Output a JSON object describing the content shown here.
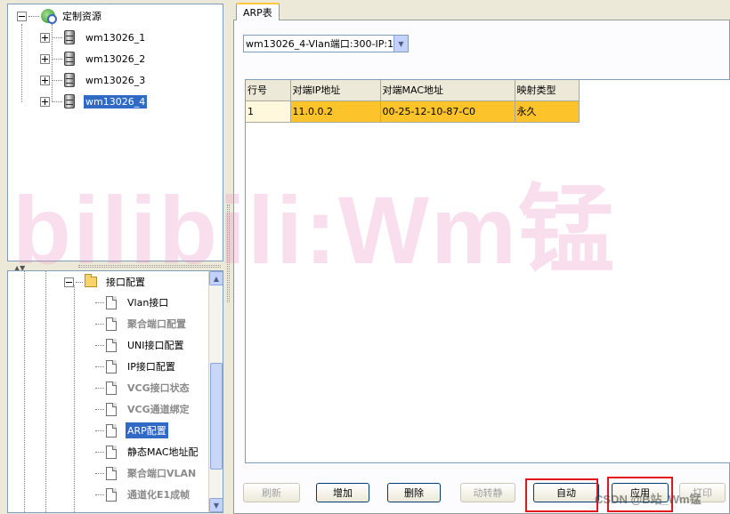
{
  "resource_tree": {
    "root_label": "定制资源",
    "nodes": [
      "wm13026_1",
      "wm13026_2",
      "wm13026_3",
      "wm13026_4"
    ],
    "selected_index": 3
  },
  "config_tree": {
    "folder_label": "接口配置",
    "items": [
      {
        "label": "Vlan接口",
        "style": "normal"
      },
      {
        "label": "聚合端口配置",
        "style": "gray"
      },
      {
        "label": "UNI接口配置",
        "style": "normal"
      },
      {
        "label": "IP接口配置",
        "style": "normal"
      },
      {
        "label": "VCG接口状态",
        "style": "gray"
      },
      {
        "label": "VCG通道绑定",
        "style": "gray"
      },
      {
        "label": "ARP配置",
        "style": "selected"
      },
      {
        "label": "静态MAC地址配",
        "style": "normal"
      },
      {
        "label": "聚合端口VLAN",
        "style": "gray"
      },
      {
        "label": "通道化E1成帧",
        "style": "gray"
      }
    ]
  },
  "tab": {
    "label": "ARP表"
  },
  "port_select": {
    "value": "wm13026_4-Vlan端口:300-IP:1"
  },
  "arp_table": {
    "columns": [
      "行号",
      "对端IP地址",
      "对端MAC地址",
      "映射类型"
    ],
    "rows": [
      [
        "1",
        "11.0.0.2",
        "00-25-12-10-87-C0",
        "永久"
      ]
    ]
  },
  "buttons": {
    "refresh": "刷新",
    "add": "增加",
    "delete": "删除",
    "dyn_to_static": "动转静",
    "auto": "自动",
    "apply": "应用",
    "print": "打印"
  },
  "watermarks": {
    "big": "bilibili:Wm锰",
    "csdn": "CSDN @B站_Wm锰"
  },
  "colors": {
    "selection": "#316ac5",
    "row_highlight": "#fcc32a",
    "annotation_box": "#e2151d",
    "tab_accent": "#ffc83c"
  }
}
